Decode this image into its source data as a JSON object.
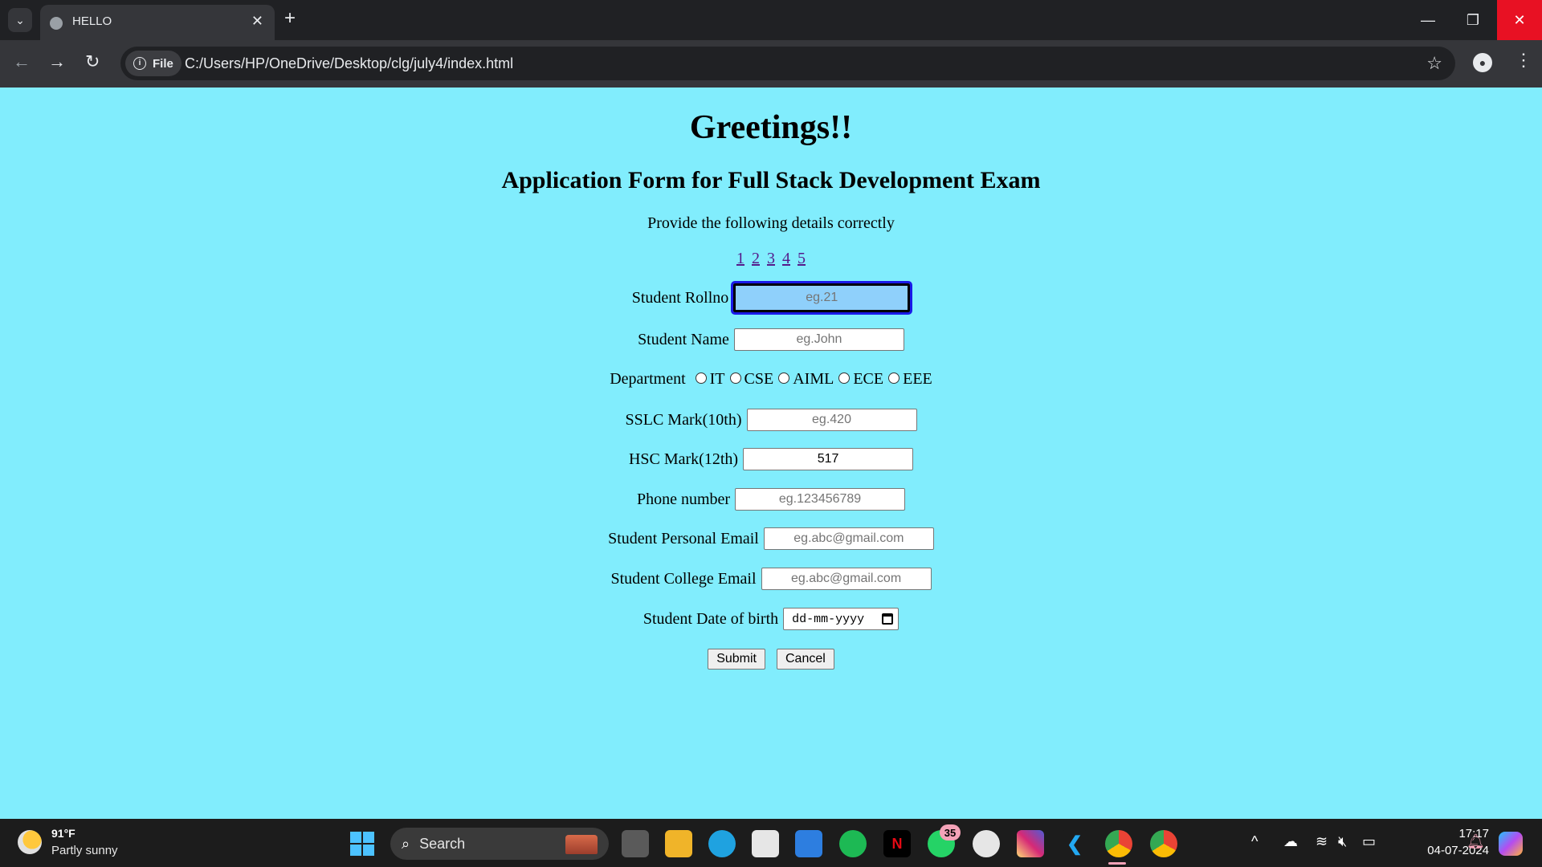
{
  "browser": {
    "tab_title": "HELLO",
    "chip_label": "File",
    "url": "C:/Users/HP/OneDrive/Desktop/clg/july4/index.html"
  },
  "page": {
    "heading": "Greetings!!",
    "subheading": "Application Form for Full Stack Development Exam",
    "intro": "Provide the following details correctly",
    "page_links": [
      "1",
      "2",
      "3",
      "4",
      "5"
    ],
    "form": {
      "rollno": {
        "label": "Student Rollno",
        "placeholder": "eg.21",
        "value": ""
      },
      "name": {
        "label": "Student Name",
        "placeholder": "eg.John",
        "value": ""
      },
      "department": {
        "label": "Department",
        "options": [
          "IT",
          "CSE",
          "AIML",
          "ECE",
          "EEE"
        ]
      },
      "sslc": {
        "label": "SSLC Mark(10th)",
        "placeholder": "eg.420",
        "value": ""
      },
      "hsc": {
        "label": "HSC Mark(12th)",
        "placeholder": "",
        "value": "517"
      },
      "phone": {
        "label": "Phone number",
        "placeholder": "eg.123456789",
        "value": ""
      },
      "personal_email": {
        "label": "Student Personal Email",
        "placeholder": "eg.abc@gmail.com",
        "value": ""
      },
      "college_email": {
        "label": "Student College Email",
        "placeholder": "eg.abc@gmail.com",
        "value": ""
      },
      "dob": {
        "label": "Student Date of birth",
        "placeholder": "dd-mm-yyyy"
      },
      "submit_label": "Submit",
      "cancel_label": "Cancel"
    }
  },
  "taskbar": {
    "temperature": "91°F",
    "condition": "Partly sunny",
    "search_label": "Search",
    "whatsapp_badge": "35",
    "time": "17:17",
    "date": "04-07-2024"
  },
  "colors": {
    "page_background": "#81edfd",
    "link": "#551a8b",
    "focus_ring": "#1a1ae8"
  }
}
